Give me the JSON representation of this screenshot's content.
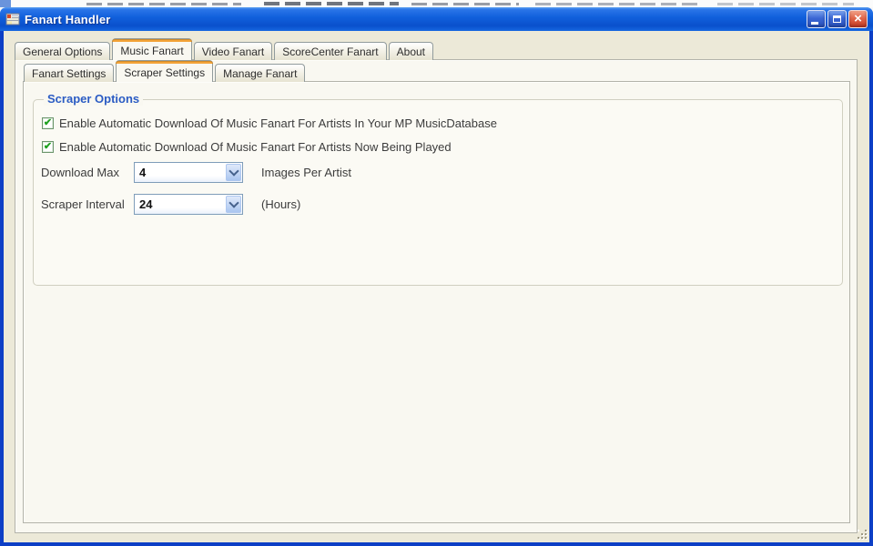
{
  "colors": {
    "titlebar_blue": "#1160dc",
    "window_border_blue": "#0d3fc6",
    "client_beige": "#ece9d8",
    "page_background": "#f9f8f1",
    "active_tab_stripe_orange": "#f3a338",
    "group_title_blue": "#2b5cc4",
    "checkmark_green": "#1fa11f",
    "close_button_red": "#d94d30",
    "combo_border_blue": "#7f9db9"
  },
  "icons": {
    "check": "✔",
    "close": "×"
  },
  "window": {
    "title": "Fanart Handler"
  },
  "tabs": {
    "items": [
      {
        "label": "General Options",
        "selected": false
      },
      {
        "label": "Music Fanart",
        "selected": true
      },
      {
        "label": "Video Fanart",
        "selected": false
      },
      {
        "label": "ScoreCenter Fanart",
        "selected": false
      },
      {
        "label": "About",
        "selected": false
      }
    ]
  },
  "subtabs": {
    "items": [
      {
        "label": "Fanart Settings",
        "selected": false
      },
      {
        "label": "Scraper Settings",
        "selected": true
      },
      {
        "label": "Manage Fanart",
        "selected": false
      }
    ]
  },
  "scraper_options": {
    "group_title": "Scraper Options",
    "checkboxes": [
      {
        "label": "Enable Automatic Download Of Music Fanart For Artists In Your MP MusicDatabase",
        "checked": true
      },
      {
        "label": "Enable Automatic Download Of Music Fanart For Artists Now Being Played",
        "checked": true
      }
    ],
    "fields": [
      {
        "label": "Download Max",
        "value": "4",
        "suffix": "Images Per Artist"
      },
      {
        "label": "Scraper Interval",
        "value": "24",
        "suffix": "(Hours)"
      }
    ]
  }
}
